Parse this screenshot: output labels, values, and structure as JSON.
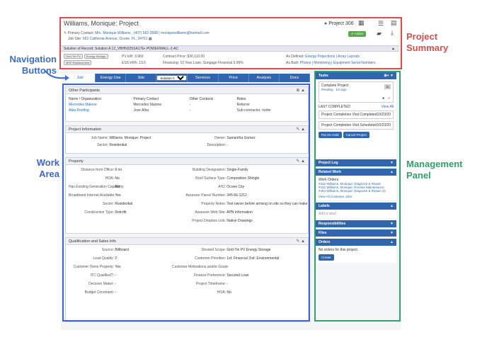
{
  "labels": {
    "project_summary": "Project Summary",
    "navigation_buttons": "Navigation Buttons",
    "work_area": "Work Area",
    "management_panel": "Management Panel"
  },
  "colors": {
    "summary_frame": "#e04b4b",
    "nav_label": "#3a6fd0",
    "work_frame": "#3f63d9",
    "mgmt_frame": "#2ea36b",
    "app_blue": "#2f66ad"
  },
  "header": {
    "title": "Williams, Monique: Project",
    "project_number": "Project 306",
    "primary_contact_label": "Primary Contact:",
    "primary_contact": "Mrs. Monique Williams , (407) 562-3588 | moniquewilliams@hotmail.com",
    "job_site_label": "Job Site:",
    "job_site": "663 California Avenue, Ocoee, FL, 34761",
    "status": "Active"
  },
  "summary": {
    "chips": [
      "Grid-Tie PV",
      "Energy Storage",
      "MSP Replacement"
    ],
    "pv_kw": "PV kW: 3.960",
    "ess_kwh": "ESS kWh: 13.5",
    "contract_price": "Contract Price: $30,110.00",
    "financing": "Financing: 10 Year Loan: Sungage Financial 3.99%",
    "as_defined_label": "As Defined:",
    "as_defined_links": "Energy Projections | Array Layouts",
    "as_built_label": "As Built:",
    "as_built_links": "Photos | Monitoring | Equipment Serial Numbers"
  },
  "solution": {
    "text": "Solution of Record: Solution A  12_VBHN325SA17E• POWERWALL-2-AC"
  },
  "nav": {
    "tabs": [
      "Job",
      "Energy Use",
      "Site",
      "Services",
      "Price",
      "Analysis",
      "Docs"
    ],
    "solution_select": "Solution A"
  },
  "participants": {
    "title": "Other Participants",
    "headers": [
      "Name / Organization",
      "Primary Contact",
      "Other Contacts",
      "Roles"
    ],
    "rows": [
      [
        "Mercedes Malone",
        "Mercedes Malone",
        "-",
        "Referrer"
      ],
      [
        "Alba Roofing",
        "Jose Alba",
        "-",
        "Sub-contractor, roofer"
      ]
    ]
  },
  "project_info": {
    "title": "Project Information",
    "job_name_label": "Job Name:",
    "job_name": "Williams, Monique: Project",
    "sector_label": "Sector:",
    "sector": "Residential",
    "owner_label": "Owner:",
    "owner": "Samantha Gomez",
    "description_label": "Description:",
    "description": "-"
  },
  "property": {
    "title": "Property",
    "left": [
      [
        "Distance from Office:",
        "9 mi"
      ],
      [
        "HOA:",
        "No"
      ],
      [
        "Has Existing Generation Capability:",
        "No"
      ],
      [
        "Broadband Internet Available:",
        "Yes"
      ],
      [
        "Sector:",
        "Residential"
      ],
      [
        "Construction Type:",
        "Retrofit"
      ]
    ],
    "right": [
      [
        "Building Designation:",
        "Single-Family"
      ],
      [
        "Roof Surface Type:",
        "Composition Shingle"
      ],
      [
        "AHJ:",
        "Ocoee City"
      ],
      [
        "Assessor Parcel Number:",
        "345-66-1212"
      ],
      [
        "Property Notes:",
        "Text owner before arriving on site so they can make sure dog is ins..."
      ],
      [
        "Assessor Web Site:",
        "APN Information"
      ],
      [
        "Project Dropbox Link:",
        "Native Drawings"
      ]
    ]
  },
  "qualification": {
    "title": "Qualification and Sales Info",
    "left": [
      [
        "Source:",
        "Billboard"
      ],
      [
        "Lead Quality:",
        "2"
      ],
      [
        "Customer Owns Property:",
        "Yes"
      ],
      [
        "ITC Qualified?:",
        "-"
      ],
      [
        "Decision Maker:",
        "-"
      ],
      [
        "Budget Constraint:",
        "-"
      ]
    ],
    "right": [
      [
        "Desired Scope:",
        "Grid-Tie PV Energy Storage"
      ],
      [
        "Customer Priorities:",
        "1st: Financial 2nd: Environmental"
      ],
      [
        "Customer Motivations and/or Goals:",
        "-"
      ],
      [
        "Finance Preference:",
        "Secured Loan"
      ],
      [
        "Project Timeframe:",
        "-"
      ],
      [
        "HOA:",
        "No"
      ]
    ]
  },
  "management": {
    "tasks_title": "Tasks",
    "task_name": "Complete Project",
    "task_status": "Pending · 1m ago",
    "task_avatar": "JL",
    "last_completed": "LAST COMPLETED",
    "view_all": "View All",
    "completed": [
      [
        "Project Completion Visit Completed",
        "10/23/20"
      ],
      [
        "Project Completion Visit Scheduled",
        "10/23/20"
      ]
    ],
    "put_on_hold": "Put On Hold",
    "cancel_project": "Cancel Project",
    "project_log": "Project Log",
    "related_work": "Related Work",
    "work_orders_label": "Work Orders",
    "work_orders": [
      "#312 Williams, Monique: Diagnose & Repair",
      "#422 Williams, Monique: Routine Maintenance",
      "#464 Williams, Monique: Diagnose & Repair (2)"
    ],
    "view_all_jobs": "View All Customer Jobs",
    "labels_title": "Labels",
    "add_label": "Add a label",
    "responsibilities": "Responsibilities",
    "files": "Files",
    "orders": "Orders",
    "no_orders": "No orders for this project.",
    "create": "Create"
  }
}
